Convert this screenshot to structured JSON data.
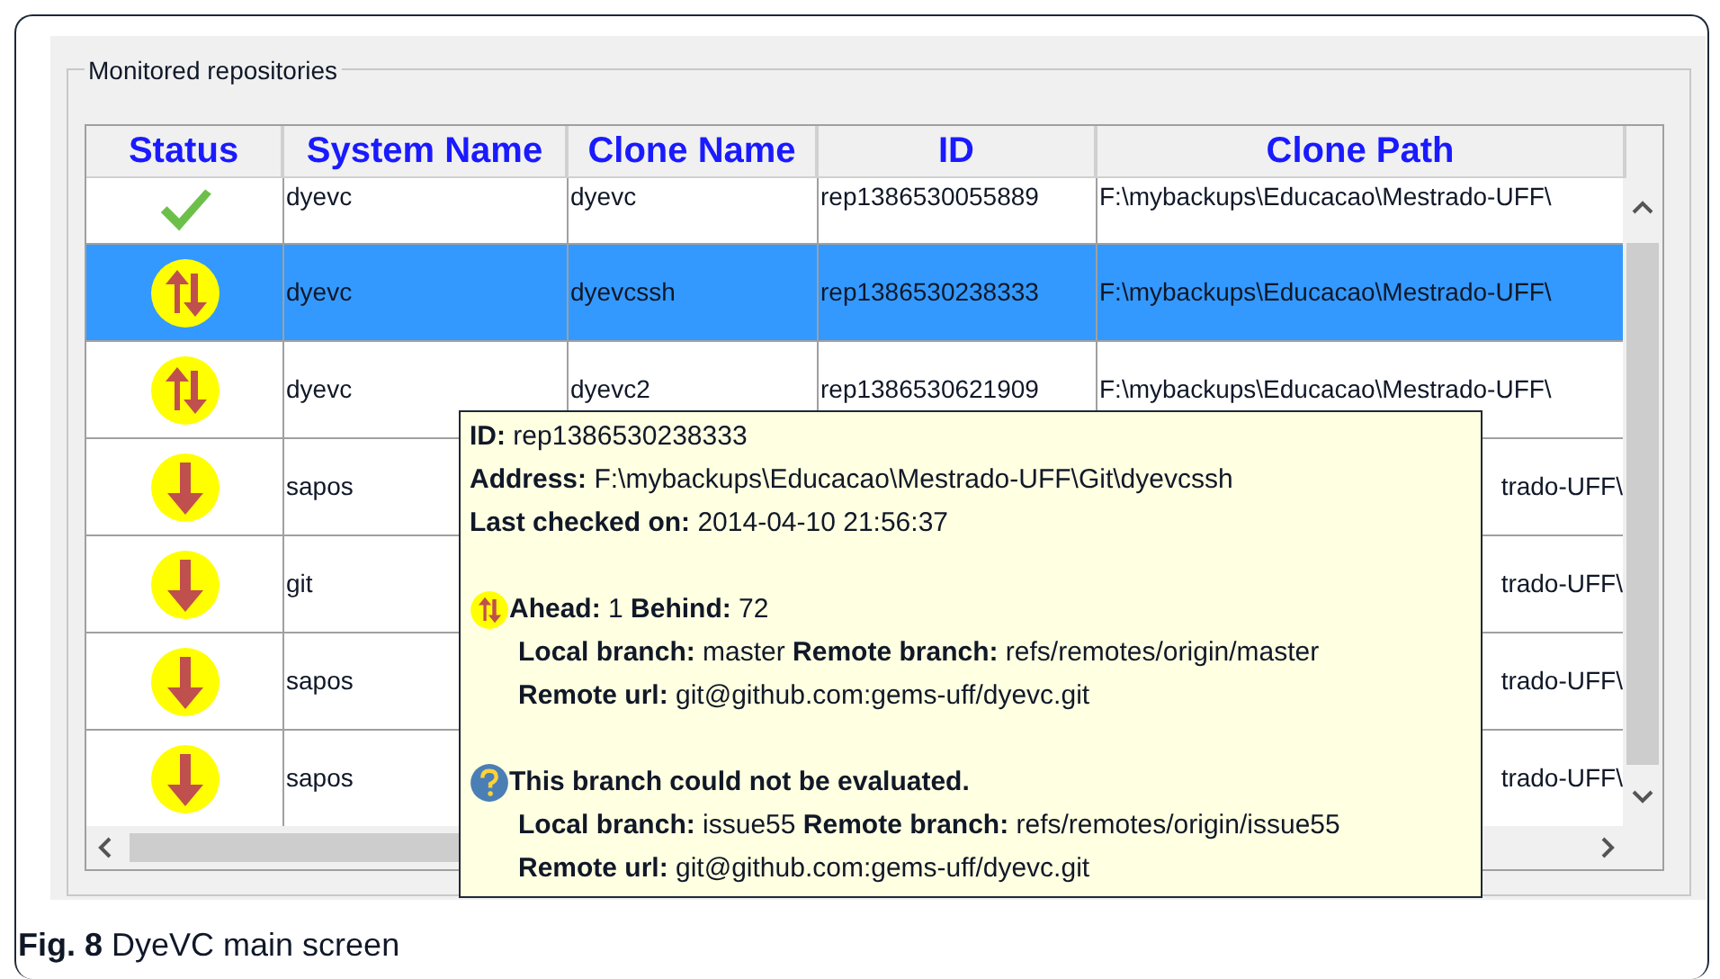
{
  "group_title": "Monitored repositories",
  "table": {
    "columns": [
      "Status",
      "System Name",
      "Clone Name",
      "ID",
      "Clone Path"
    ],
    "rows": [
      {
        "kind": "ok",
        "selected": false,
        "system_name": "dyevc",
        "clone_name": "dyevc",
        "id": "rep1386530055889",
        "clone_path": "F:\\mybackups\\Educacao\\Mestrado-UFF\\"
      },
      {
        "kind": "ahead_behind",
        "selected": true,
        "system_name": "dyevc",
        "clone_name": "dyevcssh",
        "id": "rep1386530238333",
        "clone_path": "F:\\mybackups\\Educacao\\Mestrado-UFF\\"
      },
      {
        "kind": "ahead_behind",
        "selected": false,
        "system_name": "dyevc",
        "clone_name": "dyevc2",
        "id": "rep1386530621909",
        "clone_path": "F:\\mybackups\\Educacao\\Mestrado-UFF\\"
      },
      {
        "kind": "behind",
        "selected": false,
        "system_name": "sapos",
        "clone_path": "trado-UFF\\"
      },
      {
        "kind": "behind",
        "selected": false,
        "system_name": "git",
        "clone_path": "trado-UFF\\"
      },
      {
        "kind": "behind",
        "selected": false,
        "system_name": "sapos",
        "clone_path": "trado-UFF\\"
      },
      {
        "kind": "behind",
        "selected": false,
        "system_name": "sapos",
        "clone_path": "trado-UFF\\"
      }
    ]
  },
  "tooltip": {
    "header": [
      "**ID:** rep1386530238333",
      "**Address:** F:\\mybackups\\Educacao\\Mestrado-UFF\\Git\\dyevcssh",
      "**Last checked on:** 2014-04-10 21:56:37"
    ],
    "branches": [
      {
        "kind": "ahead_behind",
        "title": "**Ahead:** 1 **Behind:** 72",
        "lines": [
          "**Local branch:** master **Remote branch:** refs/remotes/origin/master",
          "**Remote url:** git@github.com:gems-uff/dyevc.git"
        ]
      },
      {
        "kind": "unknown",
        "title": "This branch could not be evaluated.",
        "lines": [
          "**Local branch:** issue55 **Remote branch:** refs/remotes/origin/issue55",
          "**Remote url:** git@github.com:gems-uff/dyevc.git"
        ]
      }
    ]
  },
  "caption": "**Fig. 8** DyeVC main screen"
}
